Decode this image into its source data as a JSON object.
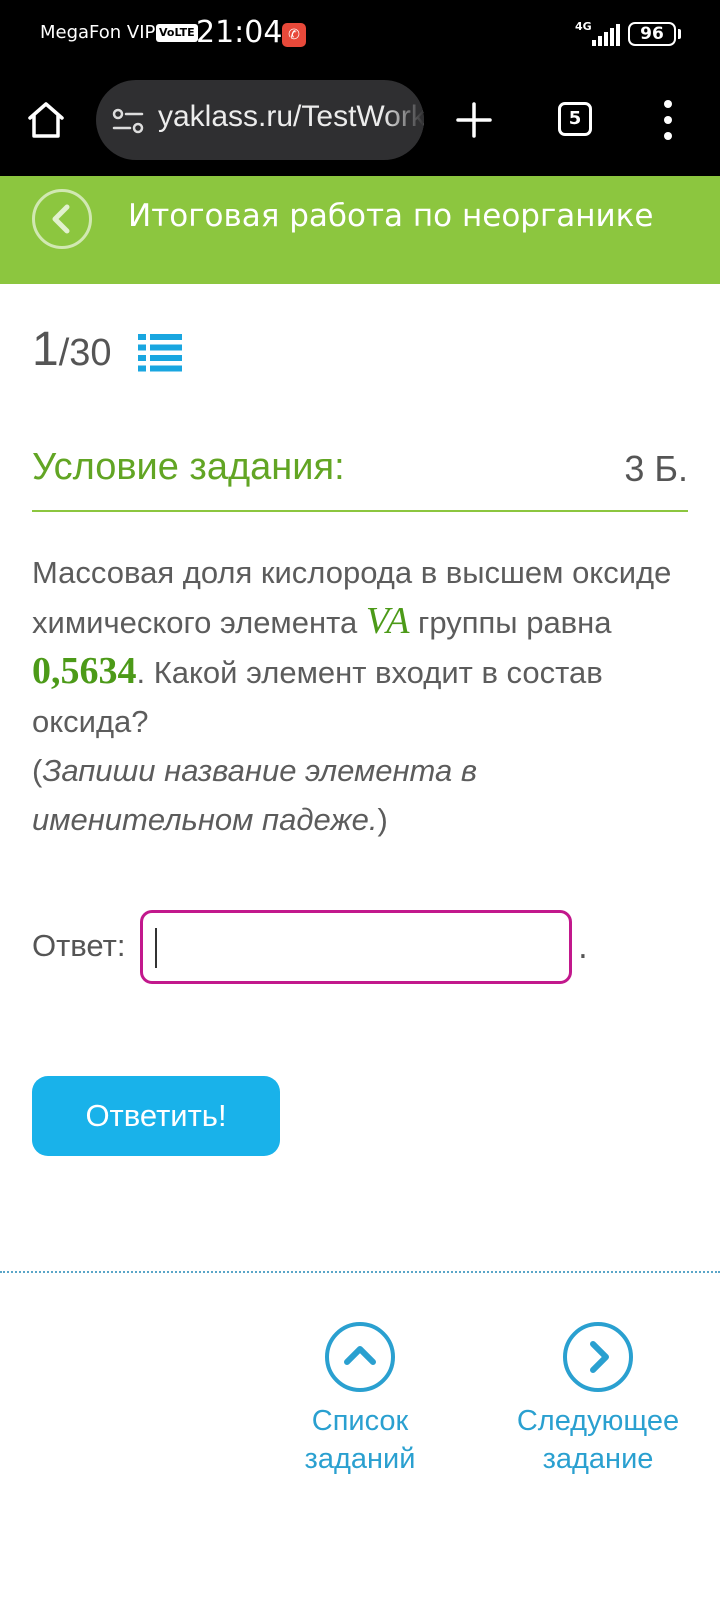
{
  "status_bar": {
    "carrier": "MegaFon VIP",
    "volte": "VoLTE",
    "time": "21:04",
    "network": "4G",
    "battery": "96"
  },
  "browser": {
    "url": "yaklass.ru/TestWork",
    "tab_count": "5"
  },
  "header": {
    "title": "Итоговая работа по неорганике"
  },
  "progress": {
    "current": "1",
    "total": "/30"
  },
  "task": {
    "title": "Условие задания:",
    "points": "3 Б.",
    "text_part1": "Массовая доля кислорода в высшем оксиде химического элемента ",
    "group": "VA",
    "text_part2": " группы равна ",
    "value": "0,5634",
    "text_part3": ". Какой элемент входит в состав оксида?",
    "note_open": "(",
    "note": "Запиши название элемента в именительном падеже.",
    "note_close": ")"
  },
  "answer": {
    "label": "Ответ:",
    "value": "",
    "suffix": "."
  },
  "submit": {
    "label": "Ответить!"
  },
  "nav": {
    "list_line1": "Список",
    "list_line2": "заданий",
    "next_line1": "Следующее",
    "next_line2": "задание"
  },
  "colors": {
    "header_green": "#8cc63f",
    "title_green": "#62a524",
    "input_border": "#c2188c",
    "button_blue": "#19b2ea",
    "link_blue": "#2aa0d0"
  }
}
